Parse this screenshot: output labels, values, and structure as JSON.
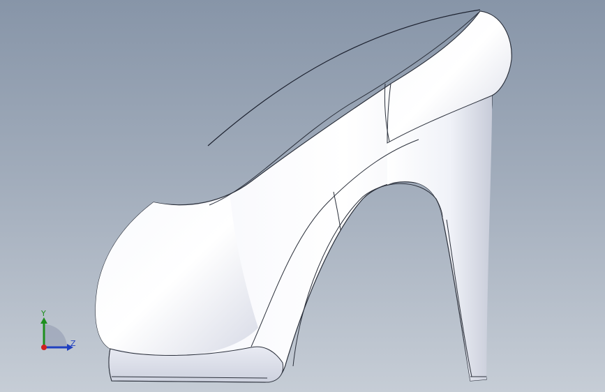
{
  "viewport": {
    "background_top": "#8795a8",
    "background_bottom": "#c6cdd6"
  },
  "model": {
    "description_icon": "high-heel-shoe-model",
    "body_color": "#f2f4fa",
    "edge_color": "#2a2f3a"
  },
  "triad": {
    "y_label": "Y",
    "z_label": "Z",
    "y_color": "#1e8f1e",
    "z_color": "#2040c0",
    "origin_color": "#d02020"
  }
}
